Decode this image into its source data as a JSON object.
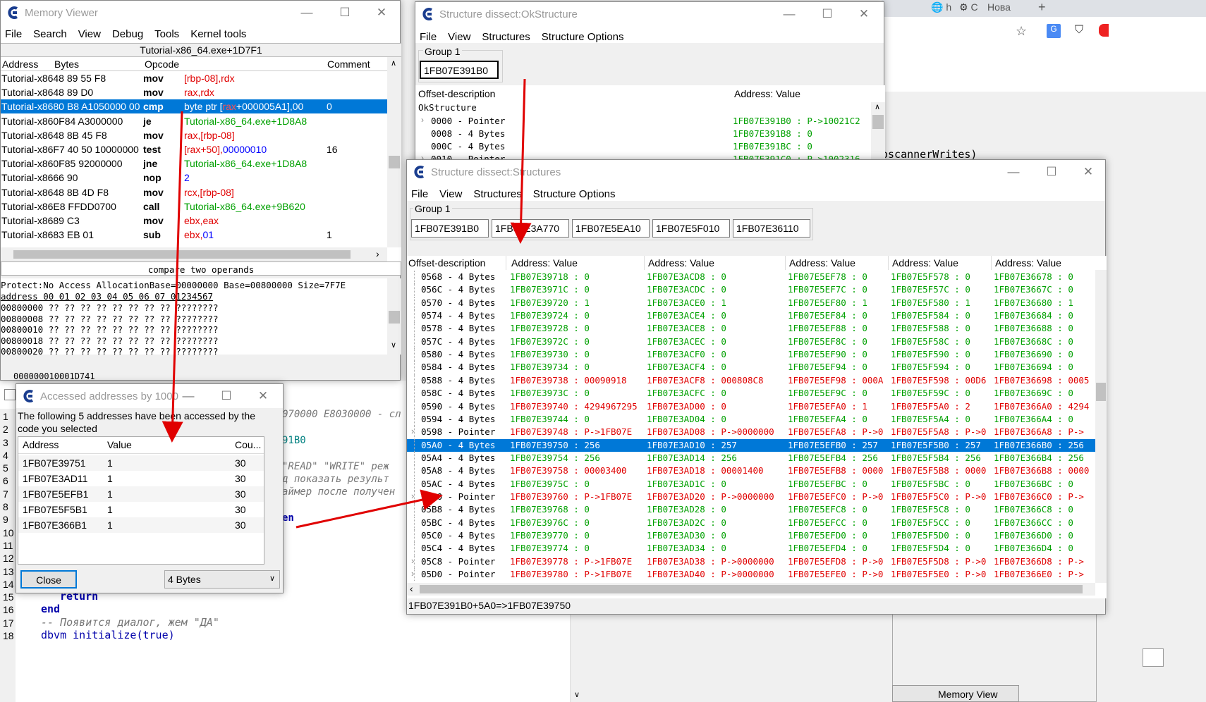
{
  "background": {
    "tabs": [
      "h",
      "С",
      "Нова"
    ],
    "new_tab": "+",
    "code_fragment": "oscannerWrites)",
    "memory_view_tab": "Memory View",
    "editor_text_1": "070000 E8030000 - сл",
    "editor_text_2": "91B0",
    "editor_text_3": "\"READ\" \"WRITE\" реж",
    "editor_text_4": "д показать результ",
    "editor_text_5": "аймер после получен",
    "editor_text_6": "en",
    "line_numbers": [
      "1",
      "2",
      "3",
      "4",
      "5",
      "6",
      "7",
      "8",
      "9",
      "10",
      "11",
      "12",
      "13",
      "14",
      "15",
      "16",
      "17",
      "18"
    ],
    "code_lines": [
      "return",
      "end",
      "-- Появится диалог, жем \"ДА\"",
      "dbvm initialize(true)"
    ]
  },
  "memory_viewer": {
    "title": "Memory Viewer",
    "menu": [
      "File",
      "Search",
      "View",
      "Debug",
      "Tools",
      "Kernel tools"
    ],
    "address_bar": "Tutorial-x86_64.exe+1D7F1",
    "columns": [
      "Address",
      "Bytes",
      "Opcode",
      "Comment"
    ],
    "rows": [
      {
        "addr": "Tutorial-x8648 89 55 F8",
        "op": "mov",
        "args": [
          [
            "[rbp",
            "r"
          ],
          [
            "-08]",
            "r"
          ],
          [
            ",rdx",
            "r"
          ]
        ],
        "comment": ""
      },
      {
        "addr": "Tutorial-x8648 89 D0",
        "op": "mov",
        "args": [
          [
            "rax,rdx",
            "r"
          ]
        ],
        "comment": ""
      },
      {
        "addr": "Tutorial-x8680 B8 A1050000 00",
        "op": "cmp",
        "args": [
          [
            "byte ptr [",
            "w"
          ],
          [
            "rax",
            "r"
          ],
          [
            "+000005A1],00",
            "w"
          ]
        ],
        "comment": "0",
        "selected": true
      },
      {
        "addr": "Tutorial-x860F84 A3000000",
        "op": "je",
        "args": [
          [
            "Tutorial-x86_64.exe+1D8A8",
            "g"
          ]
        ],
        "comment": ""
      },
      {
        "addr": "Tutorial-x8648 8B 45 F8",
        "op": "mov",
        "args": [
          [
            "rax,[rbp-08]",
            "r"
          ]
        ],
        "comment": ""
      },
      {
        "addr": "Tutorial-x86F7 40 50 10000000",
        "op": "test",
        "args": [
          [
            "[rax+50],",
            "r"
          ],
          [
            "00000010",
            "b"
          ]
        ],
        "comment": "16"
      },
      {
        "addr": "Tutorial-x860F85 92000000",
        "op": "jne",
        "args": [
          [
            "Tutorial-x86_64.exe+1D8A8",
            "g"
          ]
        ],
        "comment": ""
      },
      {
        "addr": "Tutorial-x8666 90",
        "op": "nop",
        "args": [
          [
            "2",
            "b"
          ]
        ],
        "comment": ""
      },
      {
        "addr": "Tutorial-x8648 8B 4D F8",
        "op": "mov",
        "args": [
          [
            "rcx,[rbp-08]",
            "r"
          ]
        ],
        "comment": ""
      },
      {
        "addr": "Tutorial-x86E8 FFDD0700",
        "op": "call",
        "args": [
          [
            "Tutorial-x86_64.exe+9B620",
            "g"
          ]
        ],
        "comment": ""
      },
      {
        "addr": "Tutorial-x8689 C3",
        "op": "mov",
        "args": [
          [
            "ebx,eax",
            "r"
          ]
        ],
        "comment": ""
      },
      {
        "addr": "Tutorial-x8683 EB 01",
        "op": "sub",
        "args": [
          [
            "ebx,",
            "r"
          ],
          [
            "01",
            "b"
          ]
        ],
        "comment": "1"
      }
    ],
    "status": "compare two operands",
    "hex_header": "Protect:No Access  AllocationBase=00000000 Base=00800000 Size=7F7E",
    "hex_cols": "address  00 01 02 03 04 05 06 07 01234567",
    "hex_rows": [
      "00800000 ?? ?? ?? ?? ?? ?? ?? ?? ????????",
      "00800008 ?? ?? ?? ?? ?? ?? ?? ?? ????????",
      "00800010 ?? ?? ?? ?? ?? ?? ?? ?? ????????",
      "00800018 ?? ?? ?? ?? ?? ?? ?? ?? ????????",
      "00800020 ?? ?? ?? ?? ?? ?? ?? ?? ????????"
    ],
    "below_text": "000000010001D741"
  },
  "ok_structure": {
    "title": "Structure dissect:OkStructure",
    "menu": [
      "File",
      "View",
      "Structures",
      "Structure Options"
    ],
    "group": "Group 1",
    "address": "1FB07E391B0",
    "col1": "Offset-description",
    "col2": "Address: Value",
    "root": "OkStructure",
    "rows": [
      {
        "off": "0000 - Pointer",
        "val": "1FB07E391B0 : P->10021C2",
        "exp": true
      },
      {
        "off": "0008 - 4 Bytes",
        "val": "1FB07E391B8 : 0",
        "exp": false
      },
      {
        "off": "000C - 4 Bytes",
        "val": "1FB07E391BC : 0",
        "exp": false
      },
      {
        "off": "0010 - Pointer",
        "val": "1FB07E391C0 : P->1002316",
        "exp": true
      }
    ]
  },
  "structures": {
    "title": "Structure dissect:Structures",
    "menu": [
      "File",
      "View",
      "Structures",
      "Structure Options"
    ],
    "group": "Group 1",
    "addresses": [
      "1FB07E391B0",
      "1FB07E3A770",
      "1FB07E5EA10",
      "1FB07E5F010",
      "1FB07E36110"
    ],
    "col_offset": "Offset-description",
    "col_value": "Address: Value",
    "rows": [
      {
        "off": "0568 - 4 Bytes",
        "c": "g",
        "v": [
          "1FB07E39718 : 0",
          "1FB07E3ACD8 : 0",
          "1FB07E5EF78 : 0",
          "1FB07E5F578 : 0",
          "1FB07E36678 : 0"
        ]
      },
      {
        "off": "056C - 4 Bytes",
        "c": "g",
        "v": [
          "1FB07E3971C : 0",
          "1FB07E3ACDC : 0",
          "1FB07E5EF7C : 0",
          "1FB07E5F57C : 0",
          "1FB07E3667C : 0"
        ]
      },
      {
        "off": "0570 - 4 Bytes",
        "c": "g",
        "v": [
          "1FB07E39720 : 1",
          "1FB07E3ACE0 : 1",
          "1FB07E5EF80 : 1",
          "1FB07E5F580 : 1",
          "1FB07E36680 : 1"
        ]
      },
      {
        "off": "0574 - 4 Bytes",
        "c": "g",
        "v": [
          "1FB07E39724 : 0",
          "1FB07E3ACE4 : 0",
          "1FB07E5EF84 : 0",
          "1FB07E5F584 : 0",
          "1FB07E36684 : 0"
        ]
      },
      {
        "off": "0578 - 4 Bytes",
        "c": "g",
        "v": [
          "1FB07E39728 : 0",
          "1FB07E3ACE8 : 0",
          "1FB07E5EF88 : 0",
          "1FB07E5F588 : 0",
          "1FB07E36688 : 0"
        ]
      },
      {
        "off": "057C - 4 Bytes",
        "c": "g",
        "v": [
          "1FB07E3972C : 0",
          "1FB07E3ACEC : 0",
          "1FB07E5EF8C : 0",
          "1FB07E5F58C : 0",
          "1FB07E3668C : 0"
        ]
      },
      {
        "off": "0580 - 4 Bytes",
        "c": "g",
        "v": [
          "1FB07E39730 : 0",
          "1FB07E3ACF0 : 0",
          "1FB07E5EF90 : 0",
          "1FB07E5F590 : 0",
          "1FB07E36690 : 0"
        ]
      },
      {
        "off": "0584 - 4 Bytes",
        "c": "g",
        "v": [
          "1FB07E39734 : 0",
          "1FB07E3ACF4 : 0",
          "1FB07E5EF94 : 0",
          "1FB07E5F594 : 0",
          "1FB07E36694 : 0"
        ]
      },
      {
        "off": "0588 - 4 Bytes",
        "c": "r",
        "v": [
          "1FB07E39738 : 00090918",
          "1FB07E3ACF8 : 000808C8",
          "1FB07E5EF98 : 000A",
          "1FB07E5F598 : 00D6",
          "1FB07E36698 : 0005"
        ]
      },
      {
        "off": "058C - 4 Bytes",
        "c": "g",
        "v": [
          "1FB07E3973C : 0",
          "1FB07E3ACFC : 0",
          "1FB07E5EF9C : 0",
          "1FB07E5F59C : 0",
          "1FB07E3669C : 0"
        ]
      },
      {
        "off": "0590 - 4 Bytes",
        "c": "r",
        "v": [
          "1FB07E39740 : 4294967295",
          "1FB07E3AD00 : 0",
          "1FB07E5EFA0 : 1",
          "1FB07E5F5A0 : 2",
          "1FB07E366A0 : 4294"
        ]
      },
      {
        "off": "0594 - 4 Bytes",
        "c": "g",
        "v": [
          "1FB07E39744 : 0",
          "1FB07E3AD04 : 0",
          "1FB07E5EFA4 : 0",
          "1FB07E5F5A4 : 0",
          "1FB07E366A4 : 0"
        ]
      },
      {
        "off": "0598 - Pointer",
        "c": "r",
        "exp": true,
        "v": [
          "1FB07E39748 : P->1FB07E",
          "1FB07E3AD08 : P->0000000",
          "1FB07E5EFA8 : P->0",
          "1FB07E5F5A8 : P->0",
          "1FB07E366A8 : P->"
        ]
      },
      {
        "off": "05A0 - 4 Bytes",
        "c": "w",
        "sel": true,
        "v": [
          "1FB07E39750 : 256",
          "1FB07E3AD10 : 257",
          "1FB07E5EFB0 : 257",
          "1FB07E5F5B0 : 257",
          "1FB07E366B0 : 256"
        ]
      },
      {
        "off": "05A4 - 4 Bytes",
        "c": "g",
        "v": [
          "1FB07E39754 : 256",
          "1FB07E3AD14 : 256",
          "1FB07E5EFB4 : 256",
          "1FB07E5F5B4 : 256",
          "1FB07E366B4 : 256"
        ]
      },
      {
        "off": "05A8 - 4 Bytes",
        "c": "r",
        "v": [
          "1FB07E39758 : 00003400",
          "1FB07E3AD18 : 00001400",
          "1FB07E5EFB8 : 0000",
          "1FB07E5F5B8 : 0000",
          "1FB07E366B8 : 0000"
        ]
      },
      {
        "off": "05AC - 4 Bytes",
        "c": "g",
        "v": [
          "1FB07E3975C : 0",
          "1FB07E3AD1C : 0",
          "1FB07E5EFBC : 0",
          "1FB07E5F5BC : 0",
          "1FB07E366BC : 0"
        ]
      },
      {
        "off": "05B0 - Pointer",
        "c": "r",
        "exp": true,
        "v": [
          "1FB07E39760 : P->1FB07E",
          "1FB07E3AD20 : P->0000000",
          "1FB07E5EFC0 : P->0",
          "1FB07E5F5C0 : P->0",
          "1FB07E366C0 : P->"
        ]
      },
      {
        "off": "05B8 - 4 Bytes",
        "c": "g",
        "v": [
          "1FB07E39768 : 0",
          "1FB07E3AD28 : 0",
          "1FB07E5EFC8 : 0",
          "1FB07E5F5C8 : 0",
          "1FB07E366C8 : 0"
        ]
      },
      {
        "off": "05BC - 4 Bytes",
        "c": "g",
        "v": [
          "1FB07E3976C : 0",
          "1FB07E3AD2C : 0",
          "1FB07E5EFCC : 0",
          "1FB07E5F5CC : 0",
          "1FB07E366CC : 0"
        ]
      },
      {
        "off": "05C0 - 4 Bytes",
        "c": "g",
        "v": [
          "1FB07E39770 : 0",
          "1FB07E3AD30 : 0",
          "1FB07E5EFD0 : 0",
          "1FB07E5F5D0 : 0",
          "1FB07E366D0 : 0"
        ]
      },
      {
        "off": "05C4 - 4 Bytes",
        "c": "g",
        "v": [
          "1FB07E39774 : 0",
          "1FB07E3AD34 : 0",
          "1FB07E5EFD4 : 0",
          "1FB07E5F5D4 : 0",
          "1FB07E366D4 : 0"
        ]
      },
      {
        "off": "05C8 - Pointer",
        "c": "r",
        "exp": true,
        "v": [
          "1FB07E39778 : P->1FB07E",
          "1FB07E3AD38 : P->0000000",
          "1FB07E5EFD8 : P->0",
          "1FB07E5F5D8 : P->0",
          "1FB07E366D8 : P->"
        ]
      },
      {
        "off": "05D0 - Pointer",
        "c": "r",
        "exp": true,
        "v": [
          "1FB07E39780 : P->1FB07E",
          "1FB07E3AD40 : P->0000000",
          "1FB07E5EFE0 : P->0",
          "1FB07E5F5E0 : P->0",
          "1FB07E366E0 : P->"
        ]
      }
    ],
    "status": "1FB07E391B0+5A0=>1FB07E39750"
  },
  "accessed": {
    "title": "Accessed addresses by 1000",
    "message": "The following 5 addresses have been accessed by the code you selected",
    "columns": [
      "Address",
      "Value",
      "Cou..."
    ],
    "rows": [
      [
        "1FB07E39751",
        "1",
        "30"
      ],
      [
        "1FB07E3AD11",
        "1",
        "30"
      ],
      [
        "1FB07E5EFB1",
        "1",
        "30"
      ],
      [
        "1FB07E5F5B1",
        "1",
        "30"
      ],
      [
        "1FB07E366B1",
        "1",
        "30"
      ]
    ],
    "close_label": "Close",
    "type_value": "4 Bytes"
  },
  "colors": {
    "selection": "#0078d7",
    "green": "#00a000",
    "red": "#e00000",
    "blue": "#0000ff",
    "arrow": "#e00000"
  }
}
